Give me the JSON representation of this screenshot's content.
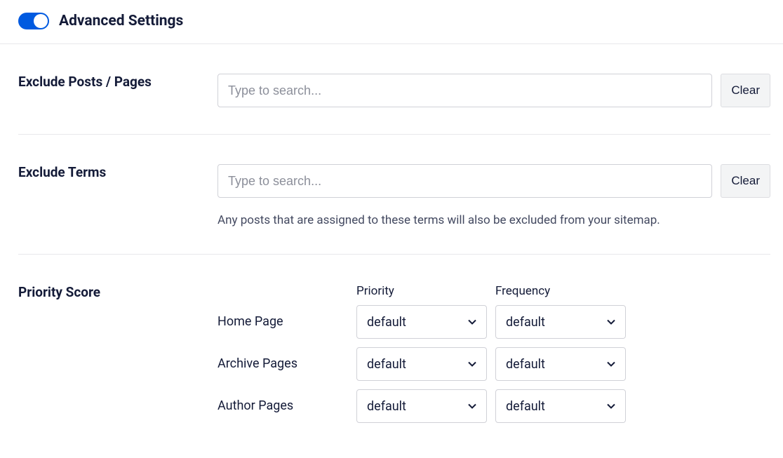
{
  "header": {
    "title": "Advanced Settings",
    "toggle_on": true
  },
  "excludePosts": {
    "label": "Exclude Posts / Pages",
    "placeholder": "Type to search...",
    "clear": "Clear"
  },
  "excludeTerms": {
    "label": "Exclude Terms",
    "placeholder": "Type to search...",
    "clear": "Clear",
    "hint": "Any posts that are assigned to these terms will also be excluded from your sitemap."
  },
  "priorityScore": {
    "label": "Priority Score",
    "columns": {
      "priority": "Priority",
      "frequency": "Frequency"
    },
    "rows": [
      {
        "label": "Home Page",
        "priority": "default",
        "frequency": "default"
      },
      {
        "label": "Archive Pages",
        "priority": "default",
        "frequency": "default"
      },
      {
        "label": "Author Pages",
        "priority": "default",
        "frequency": "default"
      }
    ]
  }
}
